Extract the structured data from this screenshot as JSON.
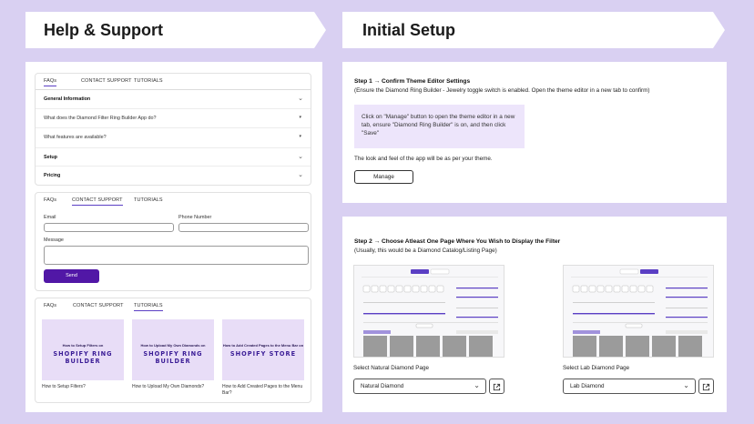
{
  "banners": {
    "left_title": "Help & Support",
    "right_title": "Initial Setup"
  },
  "tabs": {
    "faqs": "FAQs",
    "contact": "CONTACT SUPPORT",
    "tutorials": "TUTORIALS"
  },
  "faq": {
    "general_information": "General Information",
    "q1": "What does the Diamond Filter Ring Builder App do?",
    "q2": "What features are available?",
    "setup": "Setup",
    "pricing": "Pricing"
  },
  "contact": {
    "email_label": "Email",
    "phone_label": "Phone Number",
    "message_label": "Message",
    "send_label": "Send"
  },
  "tutorials": [
    {
      "line1": "How to Setup Filters on",
      "line2": "SHOPIFY RING BUILDER",
      "caption": "How to Setup Filters?"
    },
    {
      "line1": "How to Upload My Own Diamonds on",
      "line2": "SHOPIFY RING BUILDER",
      "caption": "How to Upload My Own Diamonds?"
    },
    {
      "line1": "How to Add Created Pages to the Menu Bar on",
      "line2": "SHOPIFY STORE",
      "caption": "How to Add Created Pages to the Menu Bar?"
    }
  ],
  "step1": {
    "title": "Step 1 → Confirm Theme Editor Settings",
    "subtitle": "(Ensure the Diamond Ring Builder - Jewelry toggle switch is enabled. Open the theme editor in a new tab to confirm)",
    "note": "Click on \"Manage\" button to open the theme editor in a new tab, ensure \"Diamond Ring Builder\" is on, and then click \"Save\"",
    "look_text": "The look and feel of the app will be as per your theme.",
    "manage_label": "Manage"
  },
  "step2": {
    "title": "Step 2 → Choose Atleast One Page Where You Wish to Display the Filter",
    "subtitle": "(Usually, this would be a Diamond Catalog/Listing Page)",
    "natural_label": "Select Natural Diamond Page",
    "natural_value": "Natural Diamond",
    "lab_label": "Select Lab Diamond Page",
    "lab_value": "Lab Diamond"
  },
  "colors": {
    "accent": "#5b3fc4",
    "button": "#5117a6",
    "background": "#d9d0f2",
    "tile": "#e8ddf7"
  },
  "icons": [
    "chevron-down-icon",
    "external-link-icon"
  ]
}
